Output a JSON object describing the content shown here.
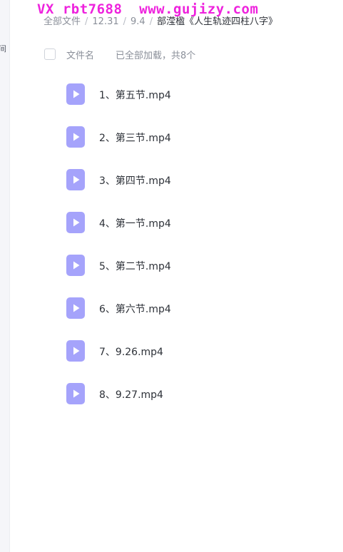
{
  "watermark": "VX rbt7688  www.gujizy.com",
  "left_rail": {
    "label": "间"
  },
  "breadcrumb": {
    "items": [
      "全部文件",
      "12.31",
      "9.4"
    ],
    "separator": "/",
    "current": "部滢楹《人生轨迹四柱八字》"
  },
  "list_header": {
    "column_name": "文件名",
    "status": "已全部加载，共8个"
  },
  "colors": {
    "video_icon": "#a5a3fb",
    "watermark": "#ee22dd"
  },
  "files": [
    {
      "name": "1、第五节.mp4",
      "icon": "video-file-icon"
    },
    {
      "name": "2、第三节.mp4",
      "icon": "video-file-icon"
    },
    {
      "name": "3、第四节.mp4",
      "icon": "video-file-icon"
    },
    {
      "name": "4、第一节.mp4",
      "icon": "video-file-icon"
    },
    {
      "name": "5、第二节.mp4",
      "icon": "video-file-icon"
    },
    {
      "name": "6、第六节.mp4",
      "icon": "video-file-icon"
    },
    {
      "name": "7、9.26.mp4",
      "icon": "video-file-icon"
    },
    {
      "name": "8、9.27.mp4",
      "icon": "video-file-icon"
    }
  ]
}
